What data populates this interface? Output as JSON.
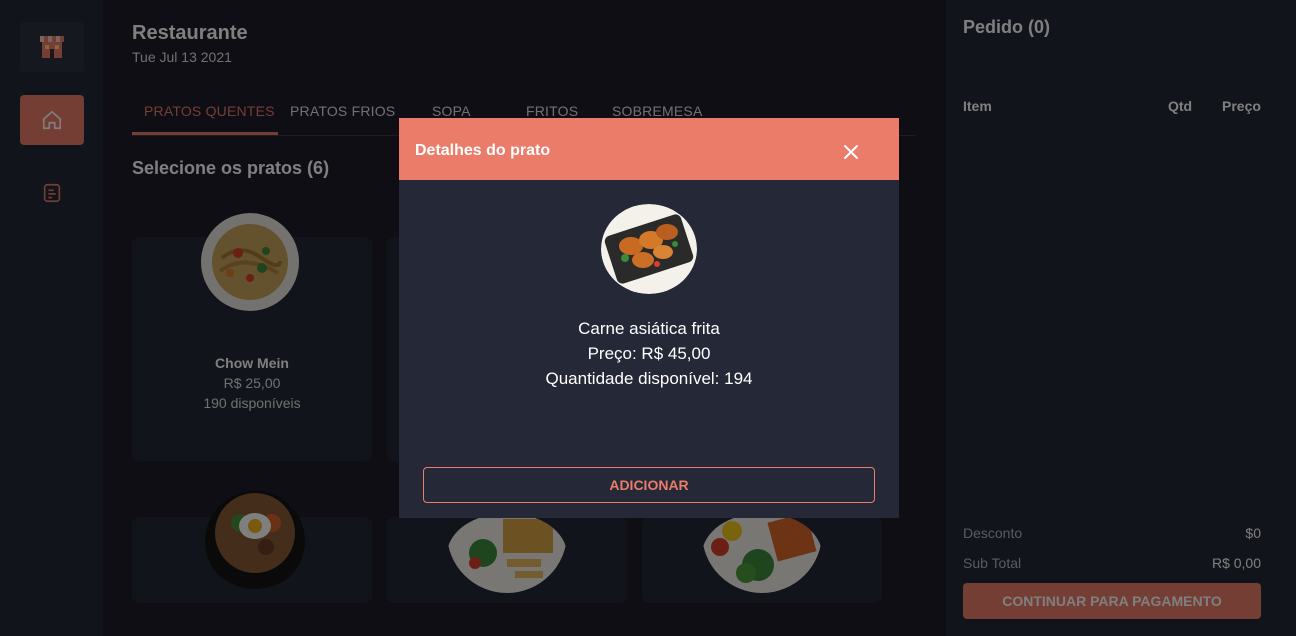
{
  "app": {
    "title": "Restaurante",
    "date": "Tue Jul 13 2021"
  },
  "sidebar": {
    "items": [
      {
        "icon": "store-icon"
      },
      {
        "icon": "home-icon"
      },
      {
        "icon": "orders-icon"
      }
    ]
  },
  "tabs": [
    "PRATOS QUENTES",
    "PRATOS FRIOS",
    "SOPA",
    "FRITOS",
    "SOBREMESA"
  ],
  "section_title": "Selecione os pratos (6)",
  "dishes": [
    {
      "name": "Chow Mein",
      "price": "R$ 25,00",
      "stock": "190 disponíveis"
    }
  ],
  "order": {
    "title": "Pedido (0)",
    "col_item": "Item",
    "col_qty": "Qtd",
    "col_price": "Preço",
    "discount_label": "Desconto",
    "discount_value": "$0",
    "subtotal_label": "Sub Total",
    "subtotal_value": "R$ 0,00",
    "pay_button": "CONTINUAR PARA PAGAMENTO"
  },
  "modal": {
    "title": "Detalhes do prato",
    "dish_name": "Carne asiática frita",
    "price_line": "Preço: R$ 45,00",
    "stock_line": "Quantidade disponível: 194",
    "add_button": "ADICIONAR"
  },
  "colors": {
    "accent": "#ea7c69",
    "background": "#1f1d2b",
    "panel": "#252836"
  }
}
